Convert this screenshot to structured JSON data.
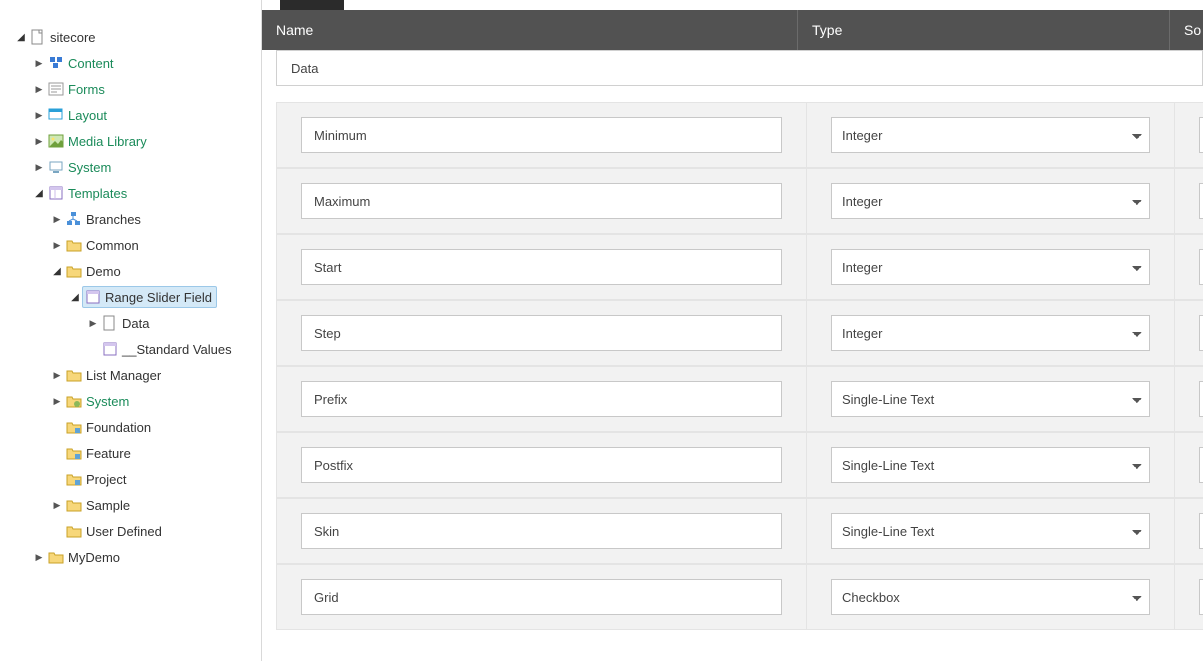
{
  "tree": {
    "root": "sitecore",
    "items": {
      "content": "Content",
      "forms": "Forms",
      "layout": "Layout",
      "media": "Media Library",
      "system": "System",
      "templates": "Templates",
      "branches": "Branches",
      "common": "Common",
      "demo": "Demo",
      "range_slider": "Range Slider Field",
      "data": "Data",
      "std_values": "__Standard Values",
      "list_manager": "List Manager",
      "system2": "System",
      "foundation": "Foundation",
      "feature": "Feature",
      "project": "Project",
      "sample": "Sample",
      "user_defined": "User Defined",
      "mydemo": "MyDemo"
    }
  },
  "headers": {
    "name": "Name",
    "type": "Type",
    "source": "So"
  },
  "section": "Data",
  "type_options": [
    "Integer",
    "Single-Line Text",
    "Checkbox"
  ],
  "fields": [
    {
      "name": "Minimum",
      "type": "Integer"
    },
    {
      "name": "Maximum",
      "type": "Integer"
    },
    {
      "name": "Start",
      "type": "Integer"
    },
    {
      "name": "Step",
      "type": "Integer"
    },
    {
      "name": "Prefix",
      "type": "Single-Line Text"
    },
    {
      "name": "Postfix",
      "type": "Single-Line Text"
    },
    {
      "name": "Skin",
      "type": "Single-Line Text"
    },
    {
      "name": "Grid",
      "type": "Checkbox"
    }
  ]
}
